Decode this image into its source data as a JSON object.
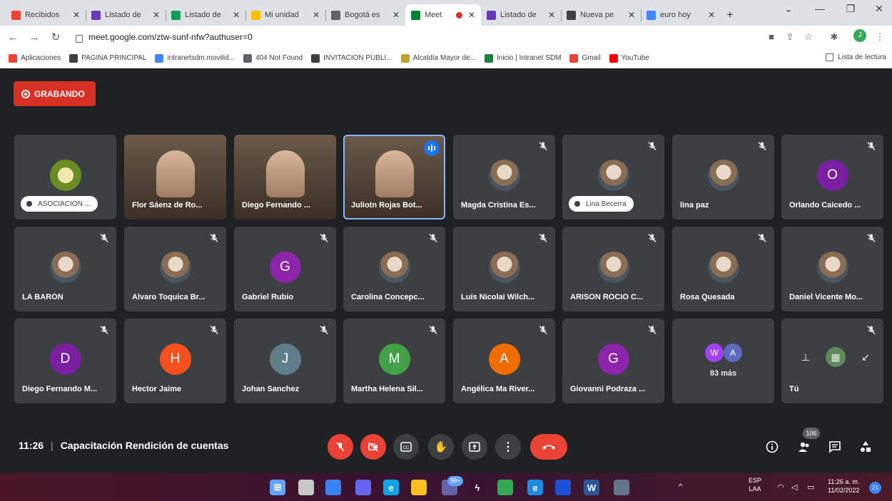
{
  "browser": {
    "tabs": [
      {
        "label": "Recibidos",
        "icon": "gmail-icon",
        "color": "#ea4335"
      },
      {
        "label": "Listado de",
        "icon": "forms-icon",
        "color": "#673ab7"
      },
      {
        "label": "Listado de",
        "icon": "sheets-icon",
        "color": "#0f9d58"
      },
      {
        "label": "Mi unidad",
        "icon": "drive-icon",
        "color": "#fbbc04"
      },
      {
        "label": "Bogotá es",
        "icon": "site-icon",
        "color": "#5f6368"
      },
      {
        "label": "Meet",
        "icon": "meet-icon",
        "color": "#00832d",
        "active": true
      },
      {
        "label": "Listado de",
        "icon": "forms-icon",
        "color": "#673ab7"
      },
      {
        "label": "Nueva pe",
        "icon": "web-icon",
        "color": "#3c4043"
      },
      {
        "label": "euro hoy",
        "icon": "google-icon",
        "color": "#4285f4"
      }
    ],
    "url": "meet.google.com/ztw-sunf-nfw?authuser=0",
    "profile_initial": "J",
    "bookmarks": [
      {
        "label": "Aplicaciones",
        "color": "#ea4335"
      },
      {
        "label": "PAGINA PRINCIPAL",
        "color": "#3c4043"
      },
      {
        "label": "intranetsdm.movilid...",
        "color": "#4285f4"
      },
      {
        "label": "404 Not Found",
        "color": "#5f6368"
      },
      {
        "label": "INVITACION PUBLI...",
        "color": "#3c4043"
      },
      {
        "label": "Alcaldía Mayor de...",
        "color": "#c0a030"
      },
      {
        "label": "Inicio | Intranet SDM",
        "color": "#1a7f3c"
      },
      {
        "label": "Gmail",
        "color": "#ea4335"
      },
      {
        "label": "YouTube",
        "color": "#ff0000"
      }
    ],
    "reading_list": "Lista de lectura"
  },
  "meet": {
    "recording_label": "GRABANDO",
    "tiles": [
      {
        "name": "ASOCIACION ...",
        "kind": "pill-photo",
        "color": "#6b8e23"
      },
      {
        "name": "Flor Sáenz de Ro...",
        "kind": "video"
      },
      {
        "name": "Diego Fernando ...",
        "kind": "video"
      },
      {
        "name": "Juliotn Rojas Bot...",
        "kind": "video",
        "speaking": true
      },
      {
        "name": "Magda Cristina Es...",
        "kind": "photo",
        "muted": true
      },
      {
        "name": "Lina Becerra",
        "kind": "pill-photo",
        "muted": true
      },
      {
        "name": "lina paz",
        "kind": "photo",
        "muted": true
      },
      {
        "name": "Orlando Caicedo ...",
        "kind": "letter",
        "letter": "O",
        "color": "#7b1fa2",
        "muted": true
      },
      {
        "name": "LA BARÓN",
        "kind": "photo",
        "muted": true
      },
      {
        "name": "Alvaro Toquica Br...",
        "kind": "photo",
        "muted": true
      },
      {
        "name": "Gabriel Rubio",
        "kind": "letter",
        "letter": "G",
        "color": "#8e24aa",
        "muted": true
      },
      {
        "name": "Carolina Concepc...",
        "kind": "photo",
        "muted": true
      },
      {
        "name": "Luis Nicolai Wilch...",
        "kind": "photo",
        "muted": true
      },
      {
        "name": "ARISON ROCIO C...",
        "kind": "photo",
        "muted": true
      },
      {
        "name": "Rosa Quesada",
        "kind": "photo",
        "muted": true
      },
      {
        "name": "Daniel Vicente Mo...",
        "kind": "photo",
        "muted": true
      },
      {
        "name": "Diego Fernando M...",
        "kind": "letter",
        "letter": "D",
        "color": "#7b1fa2",
        "muted": true
      },
      {
        "name": "Hector Jaime",
        "kind": "letter",
        "letter": "H",
        "color": "#f4511e",
        "muted": true
      },
      {
        "name": "Johan Sanchez",
        "kind": "letter",
        "letter": "J",
        "color": "#607d8b",
        "muted": true
      },
      {
        "name": "Martha Helena Sil...",
        "kind": "letter",
        "letter": "M",
        "color": "#43a047",
        "muted": true
      },
      {
        "name": "Angélica Ma River...",
        "kind": "letter",
        "letter": "A",
        "color": "#ef6c00",
        "muted": true
      },
      {
        "name": "Giovanni Podraza ...",
        "kind": "letter",
        "letter": "G",
        "color": "#8e24aa",
        "muted": true
      },
      {
        "name": "",
        "kind": "more",
        "more_letters": [
          "W",
          "A"
        ],
        "more_colors": [
          "#a142f4",
          "#5c6bc0"
        ],
        "more_text": "83 más"
      },
      {
        "name": "Tú",
        "kind": "self",
        "muted": true
      }
    ],
    "time": "11:26",
    "meeting_title": "Capacitación Rendición de cuentas",
    "participant_count": "106"
  },
  "taskbar": {
    "lang_top": "ESP",
    "lang_bottom": "LAA",
    "clock_time": "11:26 a. m.",
    "clock_date": "11/02/2022",
    "notif_count": "21",
    "teams_badge": "99+"
  }
}
